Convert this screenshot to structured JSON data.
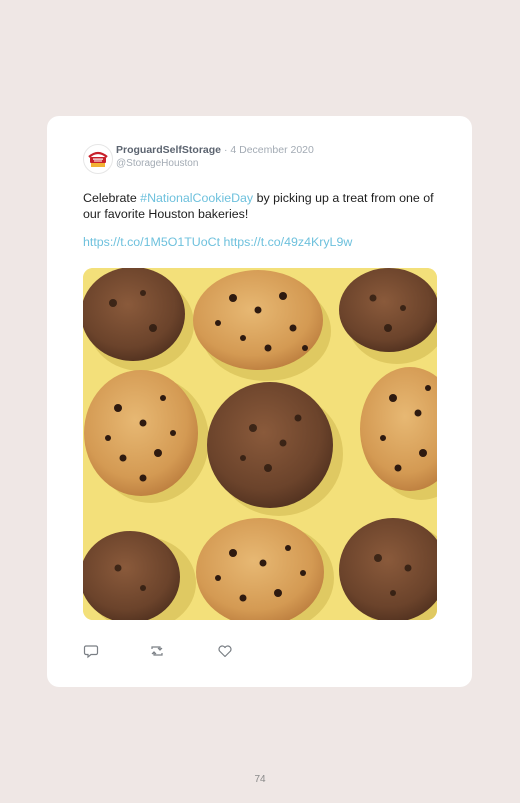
{
  "tweet": {
    "avatar_lettering": "Proguard Self Storage",
    "display_name": "ProguardSelfStorage",
    "separator": "·",
    "date": "4 December 2020",
    "handle": "@StorageHouston",
    "text_before": "Celebrate ",
    "hashtag": "#NationalCookieDay",
    "text_after": " by picking up a treat from one of our favorite Houston bakeries!",
    "link1": "https://t.co/1M5O1TUoCt",
    "link2": "https://t.co/49z4KryL9w"
  },
  "actions": {
    "reply": "reply-icon",
    "retweet": "retweet-icon",
    "like": "heart-icon"
  },
  "colors": {
    "accent": "#6ec1dd",
    "background": "#efe7e5",
    "photo_background": "#f3e07a"
  },
  "page": {
    "number": "74"
  }
}
